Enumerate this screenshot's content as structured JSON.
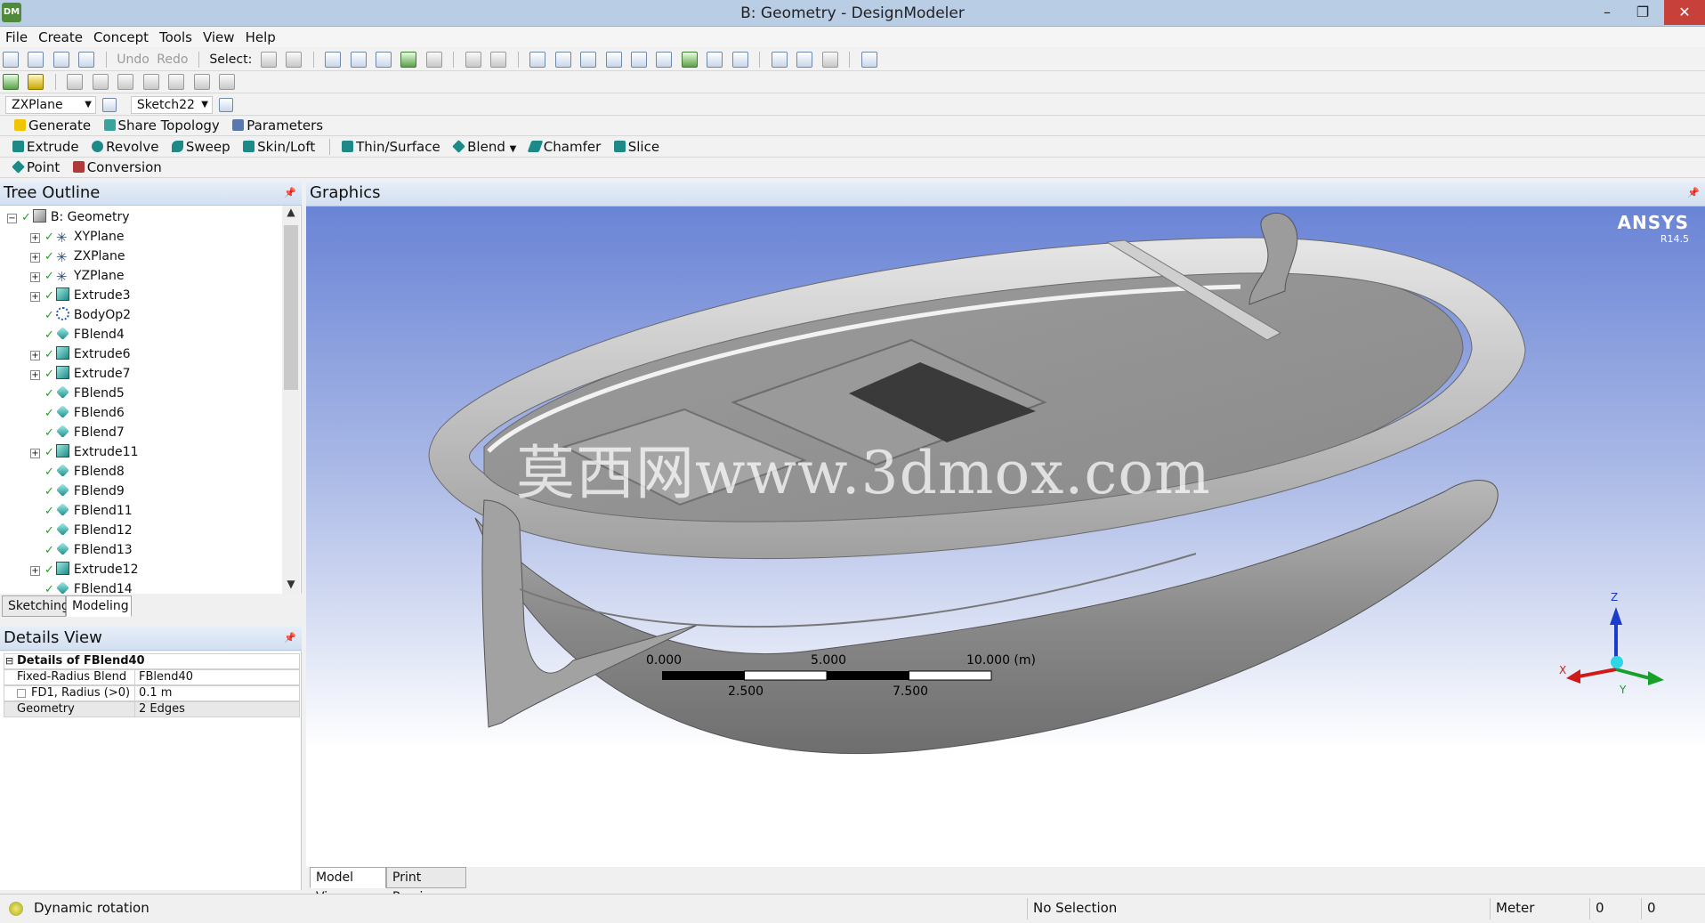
{
  "window": {
    "app_badge": "DM",
    "title": "B: Geometry - DesignModeler",
    "minimize": "–",
    "maximize": "❐",
    "close": "✕"
  },
  "menu": [
    "File",
    "Create",
    "Concept",
    "Tools",
    "View",
    "Help"
  ],
  "toolbar1": {
    "undo": "Undo",
    "redo": "Redo",
    "select_label": "Select:"
  },
  "plane_bar": {
    "plane": "ZXPlane",
    "sketch": "Sketch22"
  },
  "ops_bar1": {
    "generate": "Generate",
    "share_topology": "Share Topology",
    "parameters": "Parameters"
  },
  "ops_bar2": {
    "extrude": "Extrude",
    "revolve": "Revolve",
    "sweep": "Sweep",
    "skin_loft": "Skin/Loft",
    "thin_surface": "Thin/Surface",
    "blend": "Blend",
    "chamfer": "Chamfer",
    "slice": "Slice"
  },
  "ops_bar3": {
    "point": "Point",
    "conversion": "Conversion"
  },
  "tree_outline": {
    "title": "Tree Outline",
    "items": [
      {
        "label": "B: Geometry",
        "icon": "geometry-icon",
        "level": 0,
        "expander": "−"
      },
      {
        "label": "XYPlane",
        "icon": "plane-icon",
        "level": 1,
        "expander": "+"
      },
      {
        "label": "ZXPlane",
        "icon": "plane-icon",
        "level": 1,
        "expander": "+"
      },
      {
        "label": "YZPlane",
        "icon": "plane-icon",
        "level": 1,
        "expander": "+"
      },
      {
        "label": "Extrude3",
        "icon": "extrude-icon",
        "level": 1,
        "expander": "+"
      },
      {
        "label": "BodyOp2",
        "icon": "body-op-icon",
        "level": 1,
        "expander": ""
      },
      {
        "label": "FBlend4",
        "icon": "blend-icon",
        "level": 1,
        "expander": ""
      },
      {
        "label": "Extrude6",
        "icon": "extrude-icon",
        "level": 1,
        "expander": "+"
      },
      {
        "label": "Extrude7",
        "icon": "extrude-icon",
        "level": 1,
        "expander": "+"
      },
      {
        "label": "FBlend5",
        "icon": "blend-icon",
        "level": 1,
        "expander": ""
      },
      {
        "label": "FBlend6",
        "icon": "blend-icon",
        "level": 1,
        "expander": ""
      },
      {
        "label": "FBlend7",
        "icon": "blend-icon",
        "level": 1,
        "expander": ""
      },
      {
        "label": "Extrude11",
        "icon": "extrude-icon",
        "level": 1,
        "expander": "+"
      },
      {
        "label": "FBlend8",
        "icon": "blend-icon",
        "level": 1,
        "expander": ""
      },
      {
        "label": "FBlend9",
        "icon": "blend-icon",
        "level": 1,
        "expander": ""
      },
      {
        "label": "FBlend11",
        "icon": "blend-icon",
        "level": 1,
        "expander": ""
      },
      {
        "label": "FBlend12",
        "icon": "blend-icon",
        "level": 1,
        "expander": ""
      },
      {
        "label": "FBlend13",
        "icon": "blend-icon",
        "level": 1,
        "expander": ""
      },
      {
        "label": "Extrude12",
        "icon": "extrude-icon",
        "level": 1,
        "expander": "+"
      },
      {
        "label": "FBlend14",
        "icon": "blend-icon",
        "level": 1,
        "expander": ""
      }
    ],
    "tabs": {
      "sketching": "Sketching",
      "modeling": "Modeling"
    }
  },
  "details_view": {
    "title": "Details View",
    "header": "Details of FBlend40",
    "rows": [
      {
        "key": "Fixed-Radius Blend",
        "value": "FBlend40"
      },
      {
        "key": "FD1, Radius (>0)",
        "value": "0.1 m"
      },
      {
        "key": "Geometry",
        "value": "2 Edges"
      }
    ]
  },
  "graphics": {
    "title": "Graphics",
    "logo": "ANSYS",
    "version": "R14.5",
    "watermark": "莫西网www.3dmox.com",
    "scale": {
      "top_labels": [
        "0.000",
        "5.000",
        "10.000 (m)"
      ],
      "bottom_labels": [
        "2.500",
        "7.500"
      ]
    },
    "axes": {
      "x": "X",
      "y": "Y",
      "z": "Z"
    },
    "tabs": {
      "model_view": "Model View",
      "print_preview": "Print Preview"
    }
  },
  "status": {
    "message": "Dynamic rotation",
    "selection": "No Selection",
    "units": "Meter",
    "val1": "0",
    "val2": "0"
  },
  "colors": {
    "titlebar": "#b9cde5",
    "panel_header": "#d3e0f0",
    "viewport_top": "#6a84d6",
    "model_gray": "#8c8c8c"
  }
}
